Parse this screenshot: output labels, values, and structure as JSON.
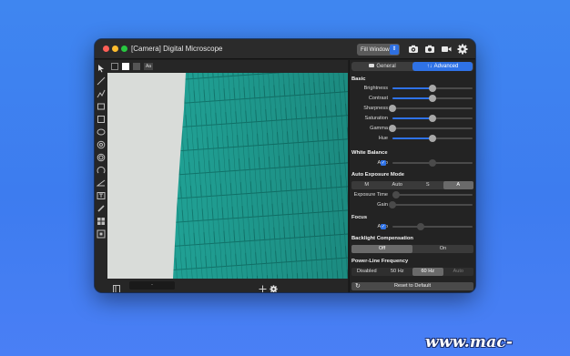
{
  "window": {
    "title": "[Camera] Digital Microscope",
    "fill_mode": "Fill Window"
  },
  "toolbar_icons": [
    "camera-settings-icon",
    "snapshot-camera-icon",
    "video-record-icon",
    "gear-icon"
  ],
  "left_tools": [
    "pointer-icon",
    "line-icon",
    "polyline-icon",
    "rectangle-icon",
    "square-icon",
    "ellipse-icon",
    "circle-icon",
    "concentric-circle-icon",
    "arc-icon",
    "angle-icon",
    "text-box-icon",
    "pencil-icon",
    "grid-icon",
    "grid-dot-icon"
  ],
  "topstrip": {
    "font_button": "Aa"
  },
  "bottombar": {
    "zoom_value": "-"
  },
  "panel": {
    "tabs": [
      {
        "label": "General",
        "active": false
      },
      {
        "label": "Advanced",
        "active": true
      }
    ],
    "basic": {
      "title": "Basic",
      "sliders": [
        {
          "label": "Brightness",
          "value": 0.5
        },
        {
          "label": "Contrast",
          "value": 0.5
        },
        {
          "label": "Sharpness",
          "value": 0.0
        },
        {
          "label": "Saturation",
          "value": 0.5
        },
        {
          "label": "Gamma",
          "value": 0.0
        },
        {
          "label": "Hue",
          "value": 0.5
        }
      ]
    },
    "white_balance": {
      "title": "White Balance",
      "auto_label": "Auto",
      "auto_checked": true,
      "value": 0.5
    },
    "auto_exposure": {
      "title": "Auto Exposure Mode",
      "options": [
        "M",
        "Auto",
        "S",
        "A"
      ],
      "selected": "A",
      "exposure_label": "Exposure Time",
      "exposure_value": 0.05,
      "gain_label": "Gain",
      "gain_value": 0.0
    },
    "focus": {
      "title": "Focus",
      "auto_label": "Auto",
      "auto_checked": true,
      "value": 0.35
    },
    "backlight": {
      "title": "Backlight Compensation",
      "options": [
        "Off",
        "On"
      ],
      "selected": "Off"
    },
    "power_line": {
      "title": "Power-Line Frequency",
      "options": [
        "Disabled",
        "50 Hz",
        "60 Hz",
        "Auto"
      ],
      "selected": "60 Hz",
      "disabled_option": "Auto"
    },
    "reset_label": "Reset to Default"
  },
  "colors": {
    "accent": "#2f72e6",
    "tissue": "#23a89b",
    "slide": "#d9dcd9"
  },
  "watermark": "www.mac-gm.com"
}
